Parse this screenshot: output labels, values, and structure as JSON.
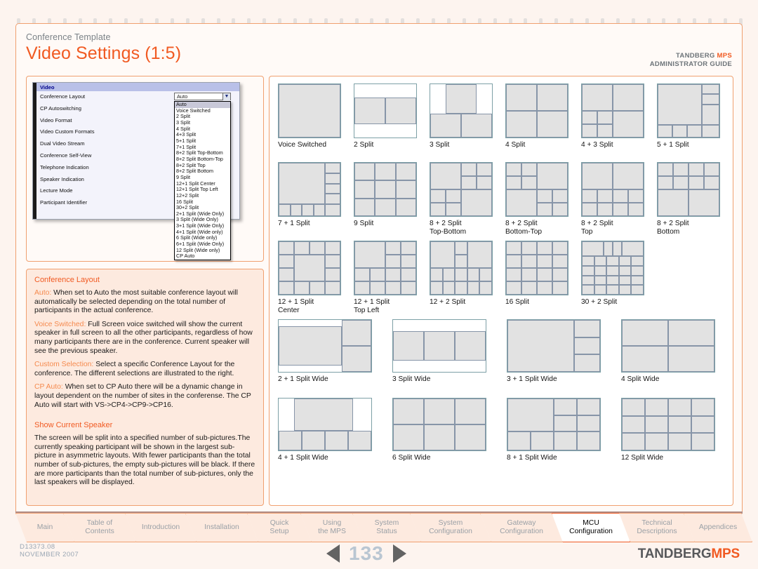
{
  "header": {
    "supertitle": "Conference Template",
    "title": "Video Settings (1:5)",
    "right_line1_a": "TANDBERG ",
    "right_line1_b": "MPS",
    "right_line2": "ADMINISTRATOR GUIDE"
  },
  "screenshot": {
    "window_title": "Video",
    "settings_rows": [
      "Conference Layout",
      "CP Autoswitching",
      "Video Format",
      "Video Custom Formats",
      "Dual Video Stream",
      "Conference Self-View",
      "Telephone Indication",
      "Speaker Indication",
      "Lecture Mode",
      "Participant Identifier"
    ],
    "combo_value": "Auto",
    "combo_icon": "chevron-down-icon",
    "dropdown_options": [
      "Auto",
      "Voice Switched",
      "2 Split",
      "3 Split",
      "4 Split",
      "4+3 Split",
      "5+1 Split",
      "7+1 Split",
      "8+2 Split Top-Bottom",
      "8+2 Split Bottom-Top",
      "8+2 Split Top",
      "8+2 Split Bottom",
      "9 Split",
      "12+1 Split Center",
      "12+1 Split Top Left",
      "12+2 Split",
      "16 Split",
      "30+2 Split",
      "2+1 Split (Wide Only)",
      "3 Split (Wide Only)",
      "3+1 Split (Wide Only)",
      "4+1 Split (Wide only)",
      "6 Split (Wide only)",
      "6+1 Split (Wide Only)",
      "12 Split (Wide only)",
      "CP Auto"
    ],
    "dropdown_selected_index": 0
  },
  "description": {
    "heading1": "Conference Layout",
    "para1_lead": "Auto:",
    "para1_body": " When set to Auto the most suitable conference layout will automatically be selected depending on the total number of participants in the actual conference.",
    "para2_lead": "Voice Switched:",
    "para2_body": " Full Screen voice switched will show the current speaker in full screen to all the other participants, regardless of how many participants there are in the conference. Current speaker will see the previous speaker.",
    "para3_lead": "Custom Selection:",
    "para3_body": " Select a specific Conference Layout for the conference. The different selections are illustrated to the right.",
    "para4_lead": "CP Auto:",
    "para4_body": " When set to CP Auto there will be a dynamic change in layout dependent on the number of sites in the conferense. The CP Auto will start with VS->CP4->CP9->CP16.",
    "heading2": "Show Current Speaker",
    "para5_body": "The screen will be split into a specified number of sub-pictures.The currently speaking participant will be shown in the largest sub-picture in asymmetric layouts. With fewer participants than the total number of sub-pictures, the empty sub-pictures will be black. If there are more participants than the total number of sub-pictures, only the last speakers will be displayed."
  },
  "layouts": [
    {
      "label": "Voice Switched",
      "label2": ""
    },
    {
      "label": "2 Split",
      "label2": ""
    },
    {
      "label": "3 Split",
      "label2": ""
    },
    {
      "label": "4 Split",
      "label2": ""
    },
    {
      "label": "4 + 3 Split",
      "label2": ""
    },
    {
      "label": "5 + 1 Split",
      "label2": ""
    },
    {
      "label": "7 + 1 Split",
      "label2": ""
    },
    {
      "label": "9 Split",
      "label2": ""
    },
    {
      "label": "8 + 2 Split",
      "label2": "Top-Bottom"
    },
    {
      "label": "8 + 2 Split",
      "label2": "Bottom-Top"
    },
    {
      "label": "8 + 2 Split",
      "label2": "Top"
    },
    {
      "label": "8 + 2 Split",
      "label2": "Bottom"
    },
    {
      "label": "12 + 1 Split",
      "label2": "Center"
    },
    {
      "label": "12 + 1 Split",
      "label2": "Top Left"
    },
    {
      "label": "12 + 2 Split",
      "label2": ""
    },
    {
      "label": "16 Split",
      "label2": ""
    },
    {
      "label": "30 + 2 Split",
      "label2": ""
    },
    {
      "label": "2 + 1 Split Wide",
      "label2": ""
    },
    {
      "label": "3 Split Wide",
      "label2": ""
    },
    {
      "label": "3 + 1 Split Wide",
      "label2": ""
    },
    {
      "label": "4 Split Wide",
      "label2": ""
    },
    {
      "label": "4 + 1 Split Wide",
      "label2": ""
    },
    {
      "label": "6 Split Wide",
      "label2": ""
    },
    {
      "label": "8 + 1 Split Wide",
      "label2": ""
    },
    {
      "label": "12 Split Wide",
      "label2": ""
    }
  ],
  "tabs": [
    {
      "line1": "Main",
      "line2": "",
      "active": false
    },
    {
      "line1": "Table of",
      "line2": "Contents",
      "active": false
    },
    {
      "line1": "Introduction",
      "line2": "",
      "active": false
    },
    {
      "line1": "Installation",
      "line2": "",
      "active": false
    },
    {
      "line1": "Quick",
      "line2": "Setup",
      "active": false
    },
    {
      "line1": "Using",
      "line2": "the MPS",
      "active": false
    },
    {
      "line1": "System",
      "line2": "Status",
      "active": false
    },
    {
      "line1": "System",
      "line2": "Configuration",
      "active": false
    },
    {
      "line1": "Gateway",
      "line2": "Configuration",
      "active": false
    },
    {
      "line1": "MCU",
      "line2": "Configuration",
      "active": true
    },
    {
      "line1": "Technical",
      "line2": "Descriptions",
      "active": false
    },
    {
      "line1": "Appendices",
      "line2": "",
      "active": false
    }
  ],
  "footer": {
    "doc_id": "D13373.08",
    "doc_date": "NOVEMBER 2007",
    "page_number": "133",
    "prev_icon": "triangle-left-icon",
    "next_icon": "triangle-right-icon",
    "brand_a": "TANDBERG",
    "brand_b": "MPS"
  },
  "colors": {
    "accent": "#f15a22",
    "panel_bg": "#fdeadf",
    "page_bg": "#fdf4ef",
    "diagram_fill": "#e2e2e2",
    "diagram_stroke": "#7da0a6"
  }
}
